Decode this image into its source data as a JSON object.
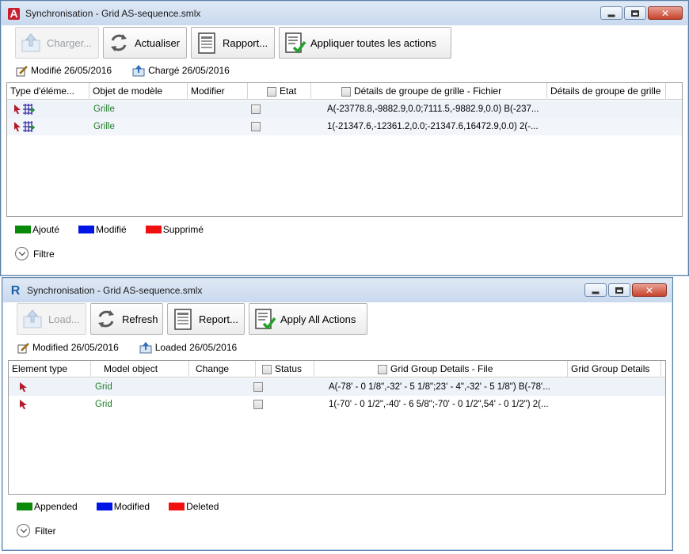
{
  "top_window": {
    "title": "Synchronisation - Grid AS-sequence.smlx",
    "toolbar": {
      "load": "Charger...",
      "refresh": "Actualiser",
      "report": "Rapport...",
      "apply_all": "Appliquer toutes les actions"
    },
    "status": {
      "modified": "Modifié 26/05/2016",
      "loaded": "Chargé 26/05/2016"
    },
    "columns": [
      "Type d'éléme...",
      "Objet de modèle",
      "Modifier",
      "Etat",
      "Détails de groupe de grille - Fichier",
      "Détails de groupe de grille"
    ],
    "rows": [
      {
        "model_object": "Grille",
        "file_details": "A(-23778.8,-9882.9,0.0;7111.5,-9882.9,0.0) B(-237..."
      },
      {
        "model_object": "Grille",
        "file_details": "1(-21347.6,-12361.2,0.0;-21347.6,16472.9,0.0) 2(-..."
      }
    ],
    "legend": {
      "appended": "Ajouté",
      "modified": "Modifié",
      "deleted": "Supprimé"
    },
    "filter": "Filtre"
  },
  "bottom_window": {
    "title": "Synchronisation - Grid AS-sequence.smlx",
    "toolbar": {
      "load": "Load...",
      "refresh": "Refresh",
      "report": "Report...",
      "apply_all": "Apply All Actions"
    },
    "status": {
      "modified": "Modified 26/05/2016",
      "loaded": "Loaded 26/05/2016"
    },
    "columns": [
      "Element type",
      "Model object",
      "Change",
      "Status",
      "Grid Group Details - File",
      "Grid Group Details"
    ],
    "rows": [
      {
        "model_object": "Grid",
        "file_details": "A(-78' - 0 1/8\",-32' - 5 1/8\";23' - 4\",-32' - 5 1/8\") B(-78'..."
      },
      {
        "model_object": "Grid",
        "file_details": "1(-70' - 0 1/2\",-40' - 6 5/8\";-70' - 0 1/2\",54' - 0 1/2\") 2(..."
      }
    ],
    "legend": {
      "appended": "Appended",
      "modified": "Modified",
      "deleted": "Deleted"
    },
    "filter": "Filter"
  },
  "colors": {
    "appended": "#0a8a0a",
    "modified": "#0014e6",
    "deleted": "#f01010",
    "green_text": "#1e7d24"
  }
}
